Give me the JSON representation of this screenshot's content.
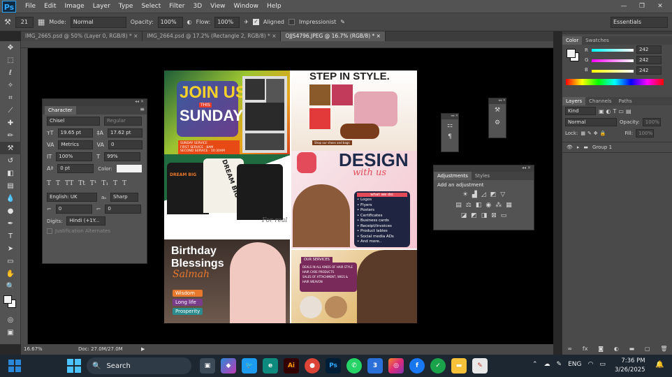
{
  "app": {
    "logo": "Ps",
    "menus": [
      "File",
      "Edit",
      "Image",
      "Layer",
      "Type",
      "Select",
      "Filter",
      "3D",
      "View",
      "Window",
      "Help"
    ]
  },
  "options": {
    "brush_size": "21",
    "mode_label": "Mode:",
    "mode": "Normal",
    "opacity_label": "Opacity:",
    "opacity": "100%",
    "flow_label": "Flow:",
    "flow": "100%",
    "aligned": "Aligned",
    "impressionist": "Impressionist",
    "workspace": "Essentials"
  },
  "tabs": [
    "IMG_2665.psd @ 50% (Layer 0, RGB/8) *",
    "IMG_2664.psd @ 17.2% (Rectangle 2, RGB/8) *",
    "OJJS4796.JPEG @ 16.7% (RGB/8) *"
  ],
  "status": {
    "zoom": "16.67%",
    "doc": "Doc: 27.0M/27.0M"
  },
  "character": {
    "title": "Character",
    "font": "Chisel",
    "style": "Regular",
    "size": "19.65 pt",
    "leading": "17.62 pt",
    "kerning": "Metrics",
    "tracking": "0",
    "vscale": "100%",
    "hscale": "99%",
    "baseline": "0 pt",
    "color_label": "Color:",
    "typestyles": [
      "T",
      "T",
      "TT",
      "Tt",
      "T¹",
      "T₁",
      "T",
      "T"
    ],
    "language": "English: UK",
    "aa_label": "aₐ",
    "antialias": "Sharp",
    "field_a": "0",
    "field_b": "0",
    "digits_label": "Digits:",
    "digits": "Hindi (+1Y...",
    "justify": "Justification Alternates"
  },
  "adjustments": {
    "tab1": "Adjustments",
    "tab2": "Styles",
    "heading": "Add an adjustment"
  },
  "color_panel": {
    "tab1": "Color",
    "tab2": "Swatches",
    "r_label": "R",
    "g_label": "G",
    "b_label": "B",
    "r": "242",
    "g": "242",
    "b": "242"
  },
  "layers_panel": {
    "tab1": "Layers",
    "tab2": "Channels",
    "tab3": "Paths",
    "kind": "Kind",
    "blend": "Normal",
    "opacity_label": "Opacity:",
    "opacity": "100%",
    "lock_label": "Lock:",
    "fill_label": "Fill:",
    "fill": "100%",
    "layer": "Group 1"
  },
  "artwork": {
    "join_us": "JOIN US",
    "this": "THIS",
    "sunday": "SUNDAY",
    "sunday_service": "SUNDAY SERVICE",
    "first_service": "FIRST SERVICE  ·  8AM",
    "second_service": "SECOND SERVICE  ·  10:30AM",
    "step_in_style": "STEP IN STYLE.",
    "shop_now": "Shop our shoes and bags",
    "design": "DESIGN",
    "with_us": "with us",
    "we_do": "what we do:",
    "services": [
      "Logos",
      "Flyers",
      "Posters",
      "Certificates",
      "Business cards",
      "Receipt/invoices",
      "Product lables",
      "Social media ADs",
      "And  more.."
    ],
    "dream_big": "DREAM BIG",
    "dream_big_brand": "DREAM BIG",
    "for_real": "For real",
    "birthday": "Birthday",
    "blessings": "Blessings",
    "name": "Salmah",
    "wishes": [
      "Wisdom",
      "Long life",
      "Prosperity"
    ],
    "our_services": "OUR SERVICES",
    "service_lines": [
      "DEALS IN ALL KINDS OF HAIR STYLE",
      "HAIR CARE PRODUCTS",
      "SALES OF ATTACHMENT, WIGS & HAIR WEAVON"
    ]
  },
  "taskbar": {
    "search": "Search",
    "lang": "ENG",
    "time": "7:36 PM",
    "date": "3/26/2025"
  },
  "colors": {
    "menubar": "#535353",
    "canvas": "#000000",
    "accent_blue": "#31a8ff",
    "taskbar": "#1c2732"
  }
}
